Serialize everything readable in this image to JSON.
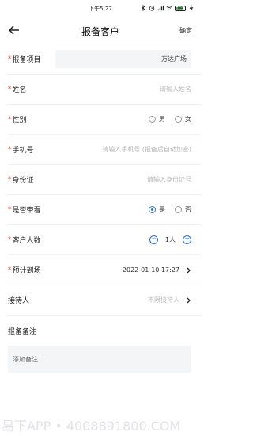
{
  "status_bar": {
    "time": "下午5:27",
    "battery": "88"
  },
  "nav": {
    "title": "报备客户",
    "confirm_label": "确定"
  },
  "form": {
    "project": {
      "label": "报备项目",
      "value": "万达广场"
    },
    "name": {
      "label": "姓名",
      "placeholder": "请输入姓名"
    },
    "gender": {
      "label": "性别",
      "options": [
        "男",
        "女"
      ]
    },
    "phone": {
      "label": "手机号",
      "placeholder": "请输入手机号 (报备后自动加密)"
    },
    "id_card": {
      "label": "身份证",
      "placeholder": "请输入身份证号"
    },
    "bring_viewing": {
      "label": "是否带看",
      "options": [
        "是",
        "否"
      ],
      "selected": "是"
    },
    "customer_count": {
      "label": "客户人数",
      "value": "1人"
    },
    "arrival": {
      "label": "预计到场",
      "value": "2022-01-10 17:27"
    },
    "receptionist": {
      "label": "接待人",
      "placeholder": "不限接待人"
    },
    "remarks": {
      "label": "报备备注",
      "placeholder": "添加备注..."
    }
  },
  "watermark": "易下APP • 4008891800.COM"
}
